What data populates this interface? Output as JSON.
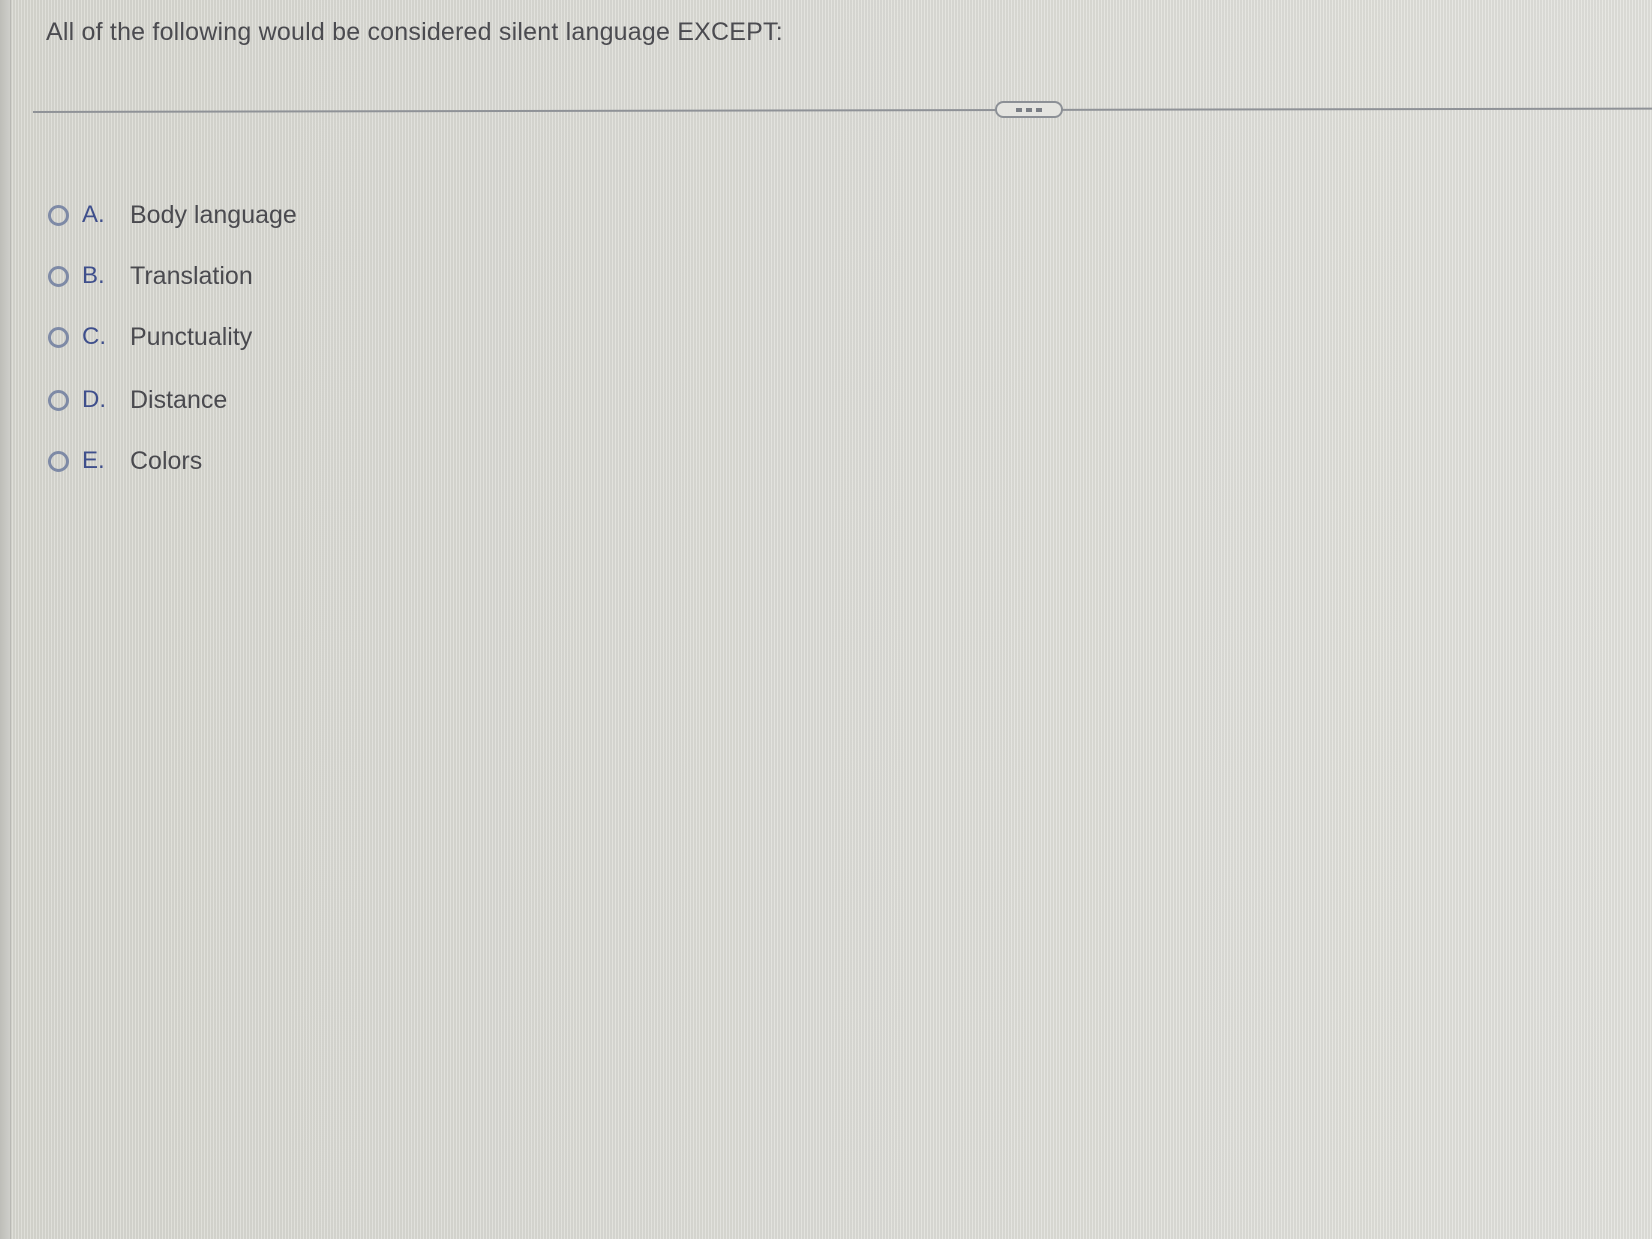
{
  "question": {
    "prompt": "All of the following would be considered silent language EXCEPT:"
  },
  "divider": {
    "more_handle_icon": "ellipsis-icon"
  },
  "options": [
    {
      "letter": "A.",
      "label": "Body language",
      "selected": false
    },
    {
      "letter": "B.",
      "label": "Translation",
      "selected": false
    },
    {
      "letter": "C.",
      "label": "Punctuality",
      "selected": false
    },
    {
      "letter": "D.",
      "label": "Distance",
      "selected": false
    },
    {
      "letter": "E.",
      "label": "Colors",
      "selected": false
    }
  ],
  "colors": {
    "background": "#d9d9d3",
    "text": "#4a4a4f",
    "letter": "#3f4f8c",
    "radio_border": "#7e8aa6",
    "divider": "#8f9297"
  }
}
